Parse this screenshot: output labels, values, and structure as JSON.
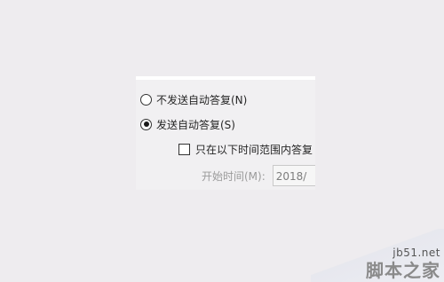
{
  "auto_reply": {
    "option_off": "不发送自动答复(N)",
    "option_on": "发送自动答复(S)",
    "selected": "option_on",
    "time_range_checkbox": "只在以下时间范围内答复",
    "time_range_checked": false,
    "start_time_label": "开始时间(M):",
    "start_date_value": "2018/"
  },
  "watermark": {
    "site": "jb51.net",
    "name": "脚本之家"
  }
}
